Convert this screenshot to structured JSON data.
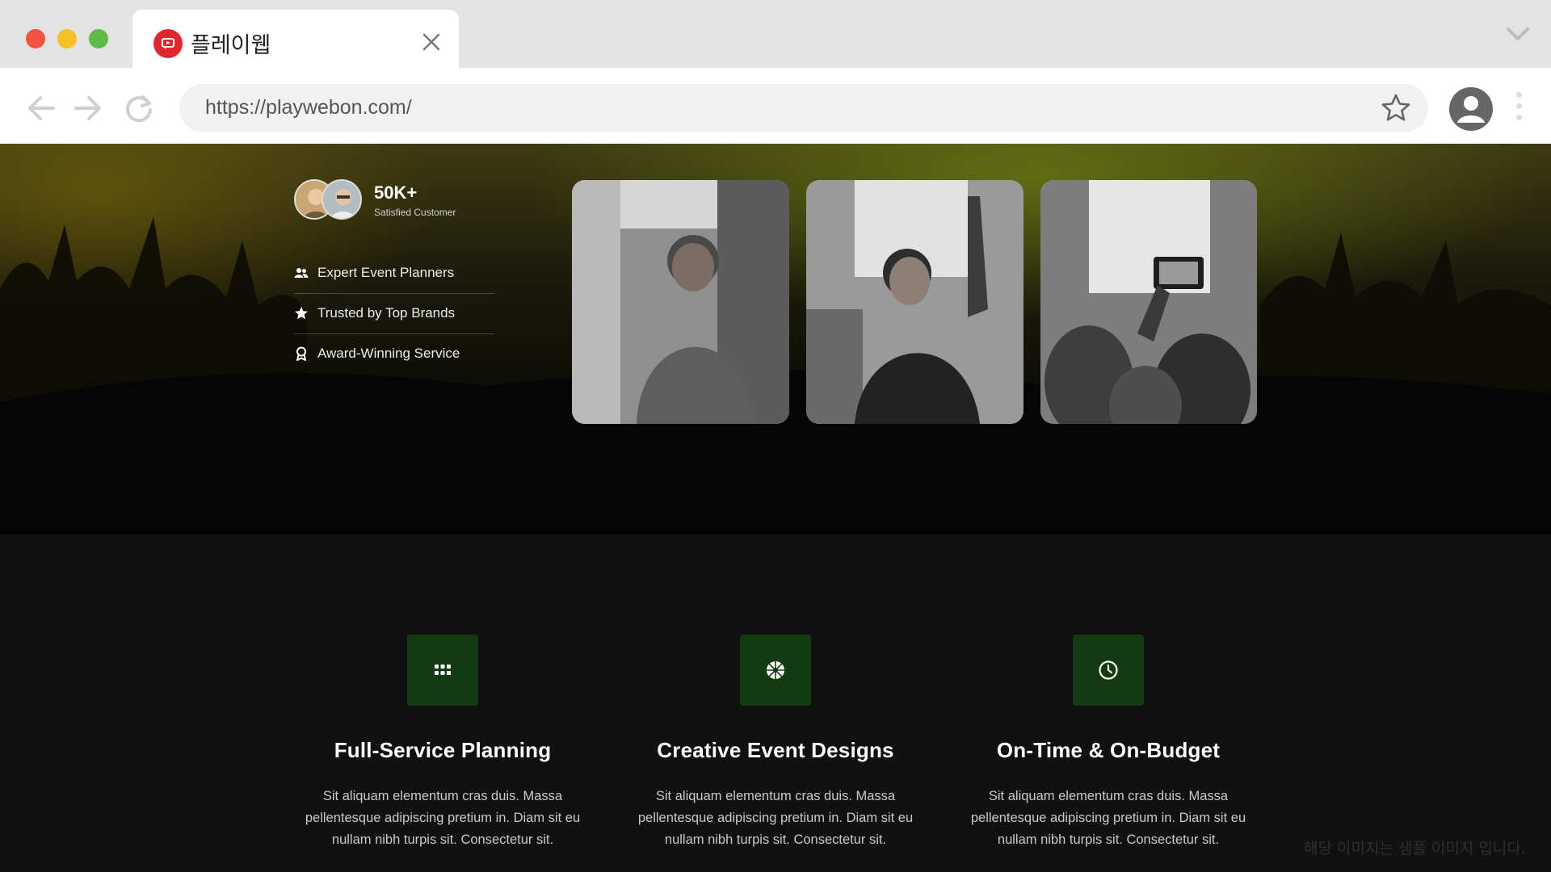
{
  "browser": {
    "tab_title": "플레이웹",
    "url": "https://playwebon.com/",
    "icons": [
      "favicon-icon",
      "close-icon",
      "chevron-down-icon",
      "back-arrow-icon",
      "forward-arrow-icon",
      "reload-icon",
      "star-icon",
      "user-icon",
      "more-vertical-icon"
    ]
  },
  "hero": {
    "stat": {
      "value": "50K+",
      "label": "Satisfied Customer"
    },
    "features": [
      {
        "label": "Expert Event Planners",
        "icon": "users-icon"
      },
      {
        "label": "Trusted by Top Brands",
        "icon": "star-icon"
      },
      {
        "label": "Award-Winning Service",
        "icon": "award-icon"
      }
    ]
  },
  "services": [
    {
      "title": "Full-Service Planning",
      "description": "Sit aliquam elementum cras duis. Massa pellentesque adipiscing pretium in. Diam sit eu nullam nibh turpis sit. Consectetur sit.",
      "icon": "grid-icon"
    },
    {
      "title": "Creative Event Designs",
      "description": "Sit aliquam elementum cras duis. Massa pellentesque adipiscing pretium in. Diam sit eu nullam nibh turpis sit. Consectetur sit.",
      "icon": "aperture-icon"
    },
    {
      "title": "On-Time & On-Budget",
      "description": "Sit aliquam elementum cras duis. Massa pellentesque adipiscing pretium in. Diam sit eu nullam nibh turpis sit. Consectetur sit.",
      "icon": "clock-icon"
    }
  ],
  "watermark": "해당 이미지는 샘플 이미지 입니다.",
  "colors": {
    "accent_green": "#133a11",
    "favicon_red": "#e0272f",
    "page_background": "#111111"
  }
}
